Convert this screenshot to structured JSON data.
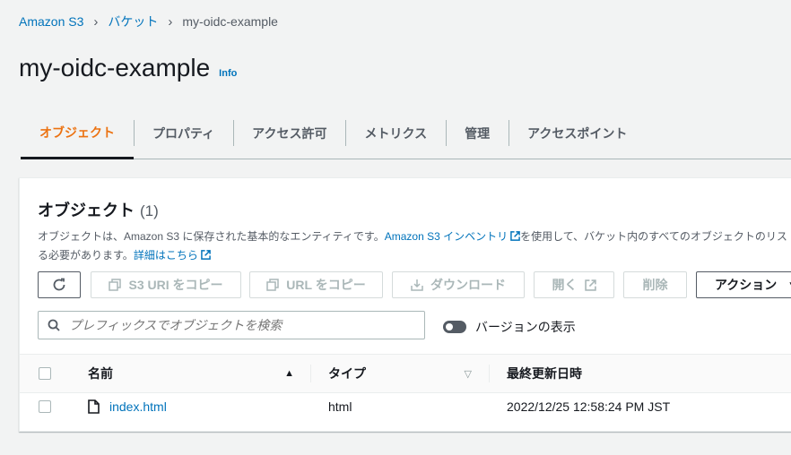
{
  "breadcrumb": {
    "root": "Amazon S3",
    "buckets": "バケット",
    "current": "my-oidc-example"
  },
  "header": {
    "title": "my-oidc-example",
    "info": "Info"
  },
  "tabs": [
    "オブジェクト",
    "プロパティ",
    "アクセス許可",
    "メトリクス",
    "管理",
    "アクセスポイント"
  ],
  "objects": {
    "title": "オブジェクト",
    "count": "(1)",
    "description_1": "オブジェクトは、Amazon S3 に保存された基本的なエンティティです。",
    "inventory_link": "Amazon S3 インベントリ",
    "description_2": "を使用して、バケット内のすべてのオブジェクトのリス",
    "description_3": "る必要があります。",
    "details_link": "詳細はこちら"
  },
  "toolbar": {
    "copy_s3_uri": "S3 URI をコピー",
    "copy_url": "URL をコピー",
    "download": "ダウンロード",
    "open": "開く",
    "delete": "削除",
    "actions": "アクション"
  },
  "search": {
    "placeholder": "プレフィックスでオブジェクトを検索"
  },
  "versions_toggle": {
    "label": "バージョンの表示"
  },
  "table": {
    "columns": [
      "名前",
      "タイプ",
      "最終更新日時"
    ],
    "rows": [
      {
        "name": "index.html",
        "type": "html",
        "last_modified": "2022/12/25 12:58:24 PM JST"
      }
    ]
  }
}
